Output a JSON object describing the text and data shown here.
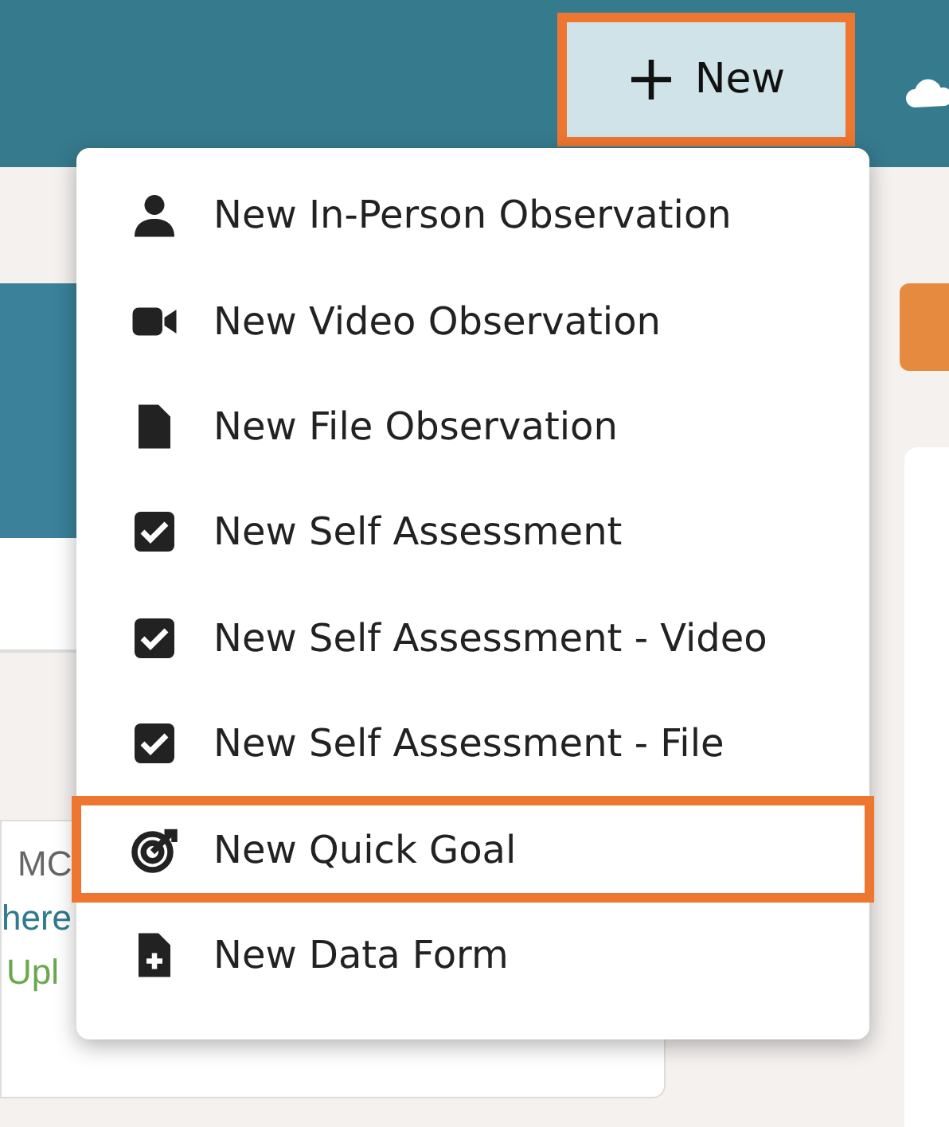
{
  "header": {
    "new_button": {
      "label": "New",
      "highlighted": true
    }
  },
  "background_card": {
    "lines": [
      {
        "kind": "author",
        "text": "MC"
      },
      {
        "kind": "link",
        "text": "here"
      },
      {
        "kind": "status",
        "text": "Upl"
      }
    ]
  },
  "menu": {
    "items": [
      {
        "kind": "person",
        "label": "New In-Person Observation",
        "highlighted": false
      },
      {
        "kind": "video",
        "label": "New Video Observation",
        "highlighted": false
      },
      {
        "kind": "file",
        "label": "New File Observation",
        "highlighted": false
      },
      {
        "kind": "check",
        "label": "New Self Assessment",
        "highlighted": false
      },
      {
        "kind": "check",
        "label": "New Self Assessment - Video",
        "highlighted": false
      },
      {
        "kind": "check",
        "label": "New Self Assessment - File",
        "highlighted": false
      },
      {
        "kind": "goal",
        "label": "New Quick Goal",
        "highlighted": true
      },
      {
        "kind": "file-plus",
        "label": "New Data Form",
        "highlighted": false
      }
    ]
  }
}
